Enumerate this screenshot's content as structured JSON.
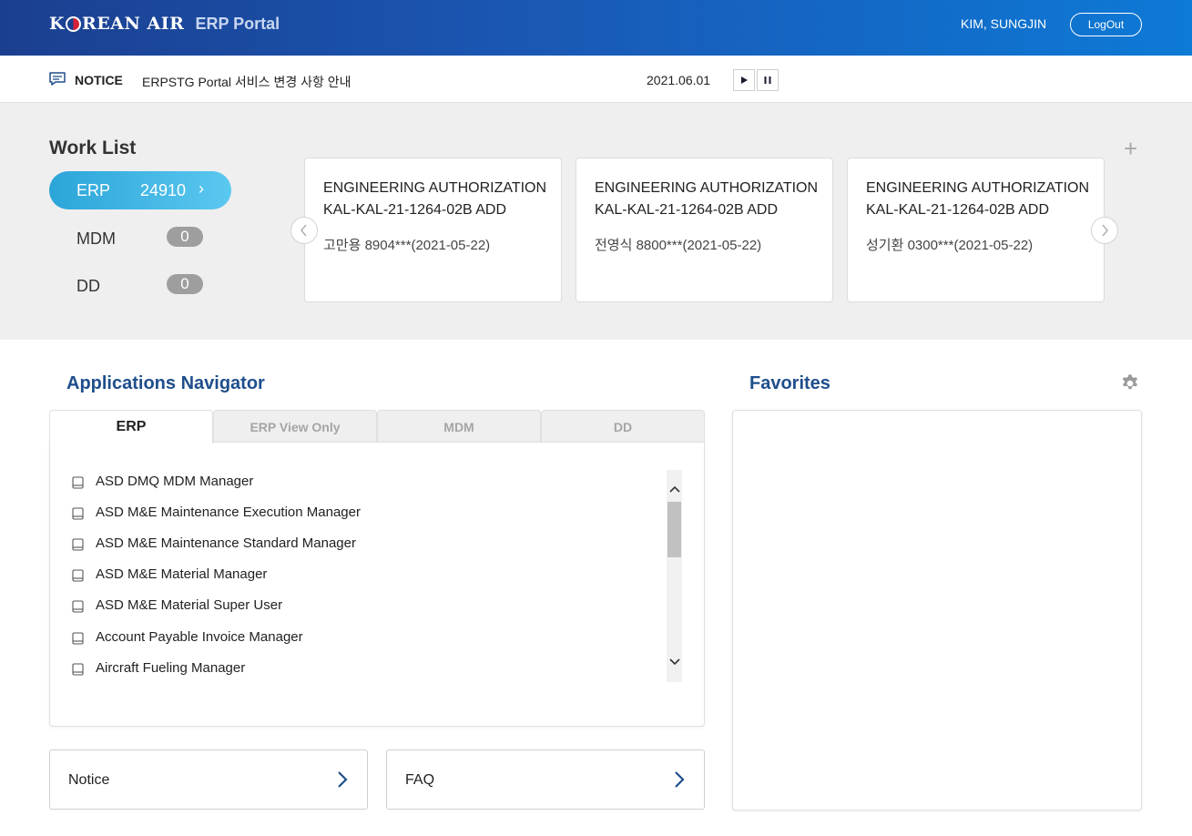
{
  "header": {
    "logo_text": "KOREAN AIR",
    "portal_title": "ERP Portal",
    "user_name": "KIM, SUNGJIN",
    "logout_label": "LogOut"
  },
  "notice_bar": {
    "label": "NOTICE",
    "text": "ERPSTG Portal 서비스 변경 사항 안내",
    "date": "2021.06.01",
    "icons": {
      "notice": "chat-bubble-icon",
      "play": "play-icon",
      "pause": "pause-icon"
    }
  },
  "work_list": {
    "title": "Work List",
    "add_icon": "plus-icon",
    "categories": [
      {
        "label": "ERP",
        "count": "24910"
      },
      {
        "label": "MDM",
        "count": "0"
      },
      {
        "label": "DD",
        "count": "0"
      }
    ],
    "cards": [
      {
        "title_line1": "ENGINEERING AUTHORIZATION",
        "title_line2": "KAL-KAL-21-1264-02B ADD",
        "meta": "고만용 8904***(2021-05-22)"
      },
      {
        "title_line1": "ENGINEERING AUTHORIZATION",
        "title_line2": "KAL-KAL-21-1264-02B ADD",
        "meta": "전영식 8800***(2021-05-22)"
      },
      {
        "title_line1": "ENGINEERING AUTHORIZATION",
        "title_line2": "KAL-KAL-21-1264-02B ADD",
        "meta": "성기환 0300***(2021-05-22)"
      }
    ]
  },
  "apps_navigator": {
    "title": "Applications Navigator",
    "tabs": [
      "ERP",
      "ERP View Only",
      "MDM",
      "DD"
    ],
    "active_tab": "ERP",
    "items": [
      "ASD DMQ MDM Manager",
      "ASD M&E Maintenance Execution Manager",
      "ASD M&E Maintenance Standard Manager",
      "ASD M&E Material Manager",
      "ASD M&E Material Super User",
      "Account Payable Invoice Manager",
      "Aircraft Fueling Manager"
    ]
  },
  "favorites": {
    "title": "Favorites",
    "settings_icon": "gear-icon"
  },
  "bottom_links": {
    "notice_label": "Notice",
    "faq_label": "FAQ"
  },
  "colors": {
    "header_start": "#1b3f8f",
    "header_end": "#0d7ad6",
    "erp_pill": "#2ba5d9",
    "section_title": "#1f4e8c"
  }
}
